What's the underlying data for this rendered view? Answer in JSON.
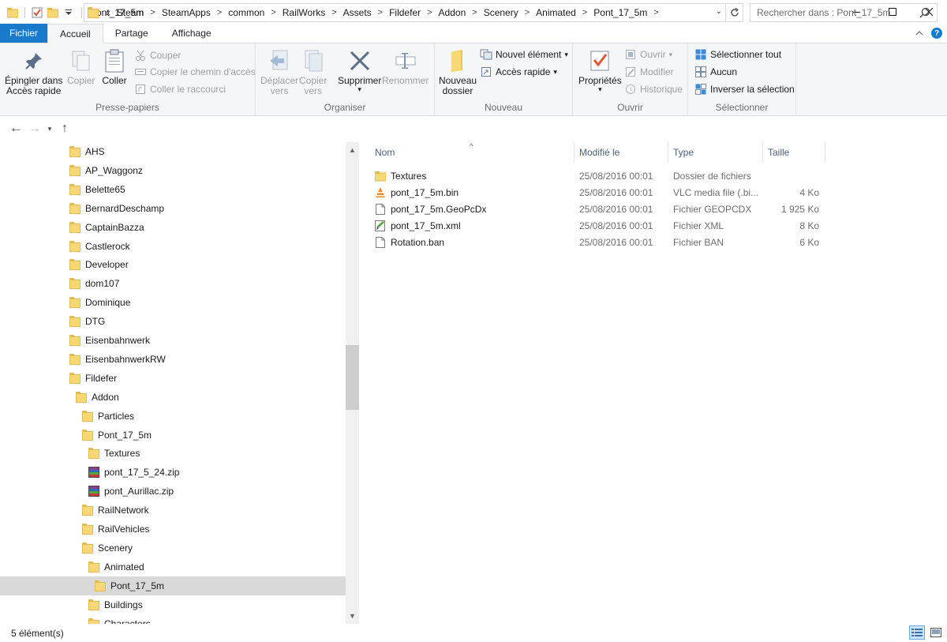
{
  "window": {
    "title": "Pont_17_5m",
    "minimize_icon": "minimize-icon",
    "maximize_icon": "maximize-icon",
    "close_icon": "close-icon"
  },
  "ribbon_tabs": [
    "Fichier",
    "Accueil",
    "Partage",
    "Affichage"
  ],
  "ribbon": {
    "clipboard": {
      "label": "Presse-papiers",
      "pin_line1": "Épingler dans",
      "pin_line2": "Accès rapide",
      "copy": "Copier",
      "paste": "Coller",
      "cut": "Couper",
      "copy_path": "Copier le chemin d'accès",
      "paste_shortcut": "Coller le raccourci"
    },
    "organize": {
      "label": "Organiser",
      "move_line1": "Déplacer",
      "move_line2": "vers",
      "copy_line1": "Copier",
      "copy_line2": "vers",
      "delete": "Supprimer",
      "rename": "Renommer"
    },
    "new": {
      "label": "Nouveau",
      "folder_line1": "Nouveau",
      "folder_line2": "dossier",
      "new_item": "Nouvel élément",
      "easy_access": "Accès rapide"
    },
    "open": {
      "label": "Ouvrir",
      "properties": "Propriétés",
      "open": "Ouvrir",
      "edit": "Modifier",
      "history": "Historique"
    },
    "select": {
      "label": "Sélectionner",
      "select_all": "Sélectionner tout",
      "select_none": "Aucun",
      "invert": "Inverser la sélection"
    }
  },
  "address": {
    "overflow": "«",
    "crumbs": [
      "Steam",
      "SteamApps",
      "common",
      "RailWorks",
      "Assets",
      "Fildefer",
      "Addon",
      "Scenery",
      "Animated",
      "Pont_17_5m"
    ],
    "search_placeholder": "Rechercher dans : Pont_17_5m"
  },
  "nav_tree": [
    {
      "label": "AHS",
      "kind": "folder"
    },
    {
      "label": "AP_Waggonz",
      "kind": "folder"
    },
    {
      "label": "Belette65",
      "kind": "folder"
    },
    {
      "label": "BernardDeschamp",
      "kind": "folder"
    },
    {
      "label": "CaptainBazza",
      "kind": "folder"
    },
    {
      "label": "Castlerock",
      "kind": "folder"
    },
    {
      "label": "Developer",
      "kind": "folder"
    },
    {
      "label": "dom107",
      "kind": "folder"
    },
    {
      "label": "Dominique",
      "kind": "folder"
    },
    {
      "label": "DTG",
      "kind": "folder"
    },
    {
      "label": "Eisenbahnwerk",
      "kind": "folder"
    },
    {
      "label": "EisenbahnwerkRW",
      "kind": "folder"
    },
    {
      "label": "Fildefer",
      "kind": "folder"
    },
    {
      "label": "Addon",
      "kind": "folder"
    },
    {
      "label": "Particles",
      "kind": "folder"
    },
    {
      "label": "Pont_17_5m",
      "kind": "folder"
    },
    {
      "label": "Textures",
      "kind": "folder"
    },
    {
      "label": "pont_17_5_24.zip",
      "kind": "zip"
    },
    {
      "label": "pont_Aurillac.zip",
      "kind": "zip"
    },
    {
      "label": "RailNetwork",
      "kind": "folder"
    },
    {
      "label": "RailVehicles",
      "kind": "folder"
    },
    {
      "label": "Scenery",
      "kind": "folder"
    },
    {
      "label": "Animated",
      "kind": "folder"
    },
    {
      "label": "Pont_17_5m",
      "kind": "folder",
      "selected": true
    },
    {
      "label": "Buildings",
      "kind": "folder"
    },
    {
      "label": "Characters",
      "kind": "folder"
    }
  ],
  "columns": [
    "Nom",
    "Modifié le",
    "Type",
    "Taille"
  ],
  "files": [
    {
      "name": "Textures",
      "date": "25/08/2016 00:01",
      "type": "Dossier de fichiers",
      "size": "",
      "icon": "folder-icon"
    },
    {
      "name": "pont_17_5m.bin",
      "date": "25/08/2016 00:01",
      "type": "VLC media file (.bi...",
      "size": "4 Ko",
      "icon": "vlc-icon"
    },
    {
      "name": "pont_17_5m.GeoPcDx",
      "date": "25/08/2016 00:01",
      "type": "Fichier GEOPCDX",
      "size": "1 925 Ko",
      "icon": "file-icon"
    },
    {
      "name": "pont_17_5m.xml",
      "date": "25/08/2016 00:01",
      "type": "Fichier XML",
      "size": "8 Ko",
      "icon": "xml-icon"
    },
    {
      "name": "Rotation.ban",
      "date": "25/08/2016 00:01",
      "type": "Fichier BAN",
      "size": "6 Ko",
      "icon": "file-icon"
    }
  ],
  "status": {
    "count": "5 élément(s)"
  },
  "colors": {
    "file_tab": "#1979ca",
    "selected_row": "#d9d9d9",
    "folder": "#f8d775"
  }
}
